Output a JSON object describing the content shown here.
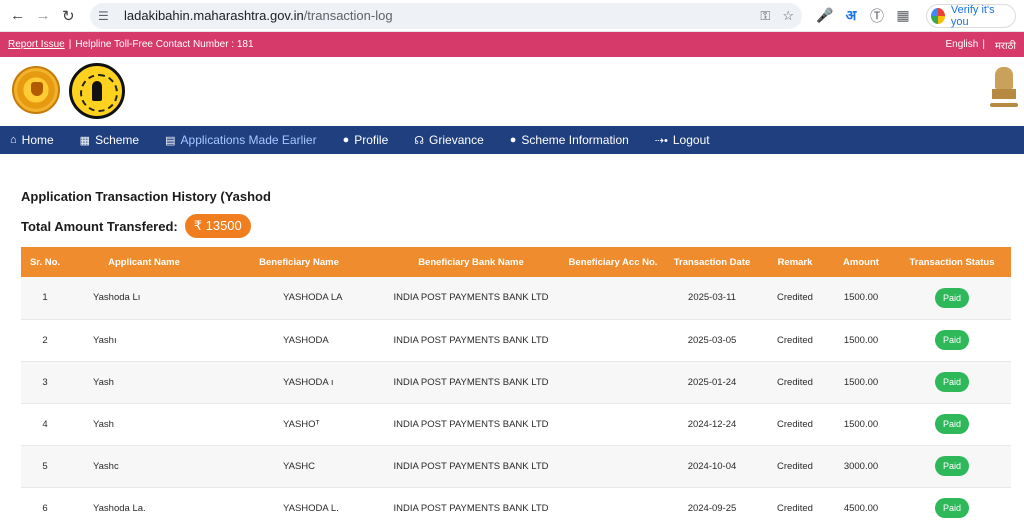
{
  "browser": {
    "url_host": "ladakibahin.maharashtra.gov.in",
    "url_path": "/transaction-log",
    "verify_label": "Verify it's you",
    "translate_glyph": "अ"
  },
  "topbar": {
    "report_issue": "Report Issue",
    "helpline": "Helpline Toll-Free Contact Number : 181",
    "lang_english": "English",
    "lang_marathi": "मराठी"
  },
  "nav": [
    {
      "label": "Home",
      "icon": "home-icon"
    },
    {
      "label": "Scheme",
      "icon": "grid-icon"
    },
    {
      "label": "Applications Made Earlier",
      "icon": "document-icon"
    },
    {
      "label": "Profile",
      "icon": "user-icon"
    },
    {
      "label": "Grievance",
      "icon": "headset-icon"
    },
    {
      "label": "Scheme Information",
      "icon": "user-icon"
    },
    {
      "label": "Logout",
      "icon": "logout-icon"
    }
  ],
  "page": {
    "title": "Application Transaction History (Yashod",
    "total_label": "Total Amount Transfered:",
    "total_amount": "₹ 13500"
  },
  "table": {
    "headers": [
      "Sr. No.",
      "Applicant Name",
      "Beneficiary Name",
      "Beneficiary Bank Name",
      "Beneficiary Acc No.",
      "Transaction Date",
      "Remark",
      "Amount",
      "Transaction Status"
    ],
    "rows": [
      {
        "sr": "1",
        "applicant": "Yashoda Lı",
        "beneficiary": "YASHODA LA",
        "bank": "INDIA POST PAYMENTS BANK LTD",
        "acc": "",
        "date": "2025-03-11",
        "remark": "Credited",
        "amount": "1500.00",
        "status": "Paid"
      },
      {
        "sr": "2",
        "applicant": "Yashı",
        "beneficiary": "YASHODA",
        "bank": "INDIA POST PAYMENTS BANK LTD",
        "acc": "",
        "date": "2025-03-05",
        "remark": "Credited",
        "amount": "1500.00",
        "status": "Paid"
      },
      {
        "sr": "3",
        "applicant": "Yash",
        "beneficiary": "YASHODA ı",
        "bank": "INDIA POST PAYMENTS BANK LTD",
        "acc": "",
        "date": "2025-01-24",
        "remark": "Credited",
        "amount": "1500.00",
        "status": "Paid"
      },
      {
        "sr": "4",
        "applicant": "Yash",
        "beneficiary": "YASHOᵀ",
        "bank": "INDIA POST PAYMENTS BANK LTD",
        "acc": "",
        "date": "2024-12-24",
        "remark": "Credited",
        "amount": "1500.00",
        "status": "Paid"
      },
      {
        "sr": "5",
        "applicant": "Yashc",
        "beneficiary": "YASHC",
        "bank": "INDIA POST PAYMENTS BANK LTD",
        "acc": "",
        "date": "2024-10-04",
        "remark": "Credited",
        "amount": "3000.00",
        "status": "Paid"
      },
      {
        "sr": "6",
        "applicant": "Yashoda La.",
        "beneficiary": "YASHODA L.",
        "bank": "INDIA POST PAYMENTS BANK LTD",
        "acc": "",
        "date": "2024-09-25",
        "remark": "Credited",
        "amount": "4500.00",
        "status": "Paid"
      }
    ]
  },
  "colors": {
    "topbar": "#d63a6b",
    "nav": "#1f3f7f",
    "table_header": "#ef8d2e",
    "badge": "#f07d1e",
    "paid": "#2fb85a"
  }
}
